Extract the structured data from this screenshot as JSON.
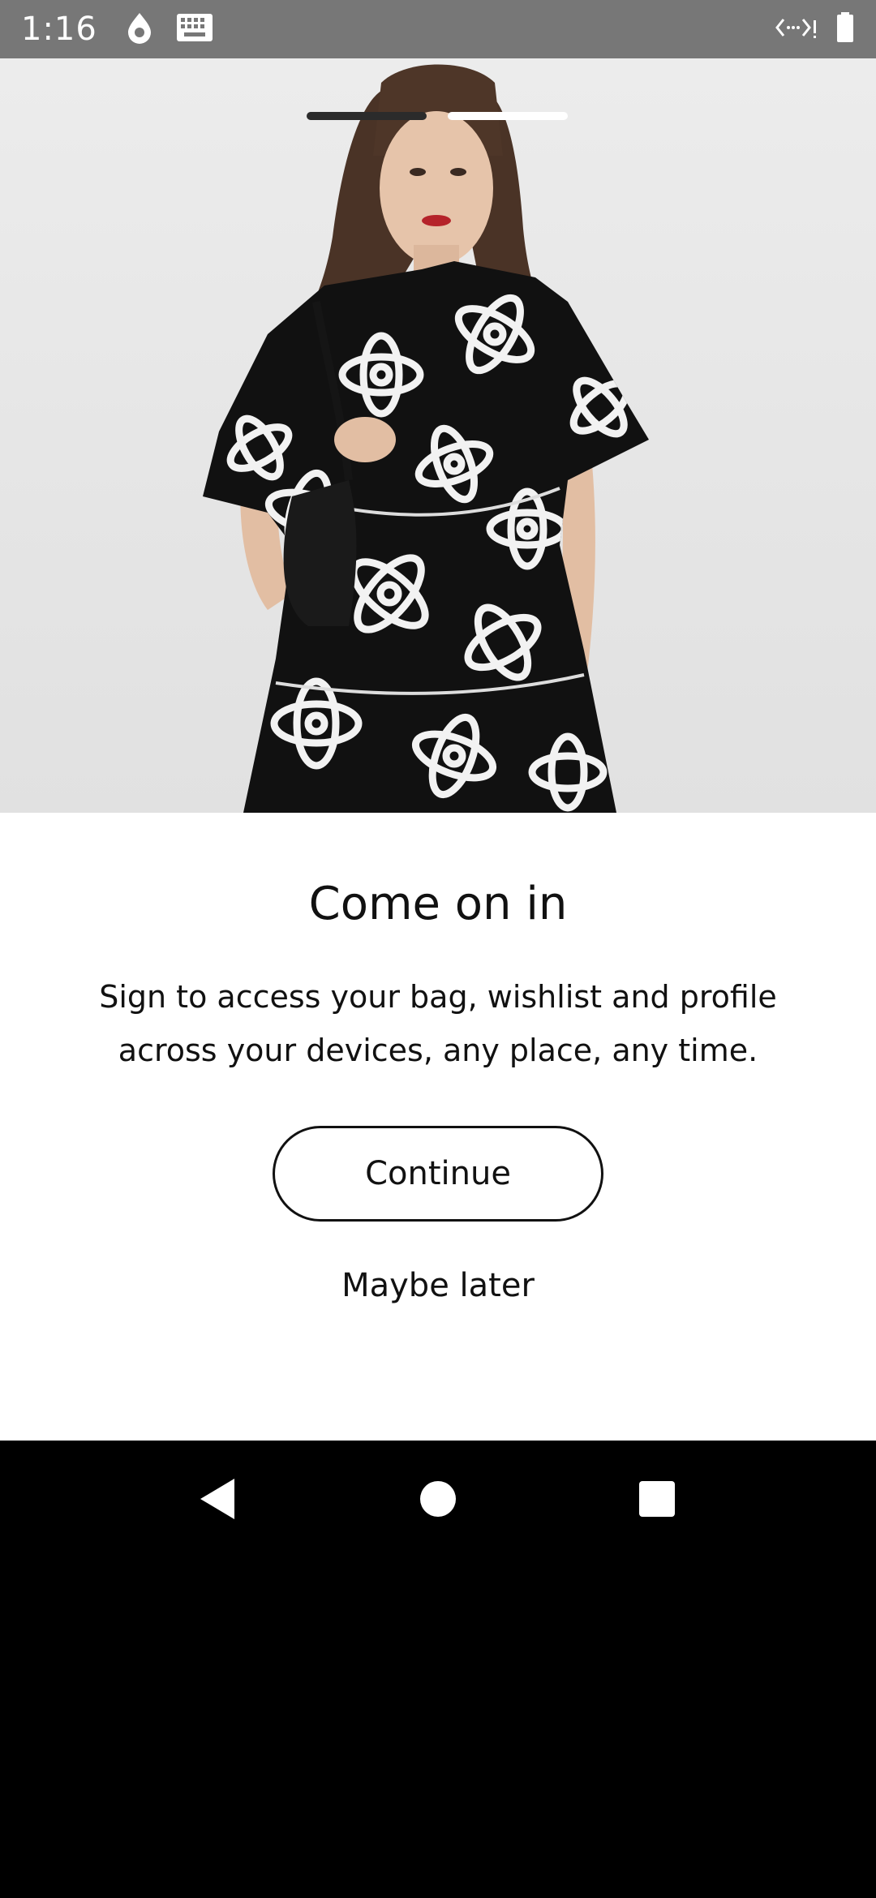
{
  "status_bar": {
    "time": "1:16",
    "icons_left": [
      "drop-icon",
      "keyboard-icon"
    ],
    "icons_right": [
      "code-signal-icon",
      "battery-icon"
    ]
  },
  "carousel": {
    "page_count": 2,
    "active_index": 0
  },
  "onboarding": {
    "title": "Come on in",
    "subtitle": "Sign to access your bag, wishlist and profile across your devices, any place, any time.",
    "continue_label": "Continue",
    "maybe_later_label": "Maybe later"
  },
  "nav_bar": {
    "buttons": [
      "back-icon",
      "home-icon",
      "recents-icon"
    ]
  },
  "colors": {
    "status_bar_bg": "#777777",
    "text": "#111111",
    "nav_bar_bg": "#000000"
  }
}
